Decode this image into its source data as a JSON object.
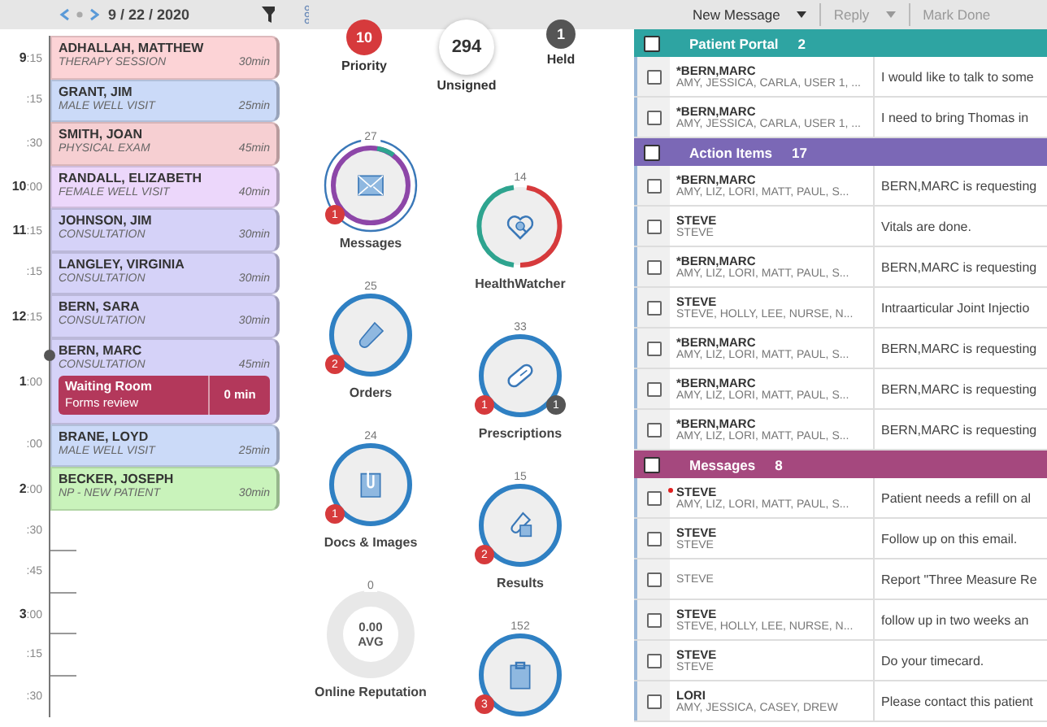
{
  "schedule": {
    "date": "9 / 22 / 2020",
    "slots": [
      {
        "time": "**9**:15",
        "patient": "ADHALLAH, MATTHEW",
        "visit": "THERAPY SESSION",
        "duration": "30min",
        "color": "#fcd3d6"
      },
      {
        "time": ":15",
        "patient": "GRANT, JIM",
        "visit": "MALE WELL VISIT",
        "duration": "25min",
        "color": "#cbdaf8"
      },
      {
        "time": ":30",
        "patient": "SMITH, JOAN",
        "visit": "PHYSICAL EXAM",
        "duration": "45min",
        "color": "#f6cfd2"
      },
      {
        "time": "**10**:00",
        "patient": "RANDALL, ELIZABETH",
        "visit": "FEMALE WELL VISIT",
        "duration": "40min",
        "color": "#ecd7fb"
      },
      {
        "time": "**11**:15",
        "patient": "JOHNSON, JIM",
        "visit": "CONSULTATION",
        "duration": "30min",
        "color": "#d5d2f8"
      },
      {
        "time": ":15",
        "patient": "LANGLEY, VIRGINIA",
        "visit": "CONSULTATION",
        "duration": "30min",
        "color": "#d5d2f8"
      },
      {
        "time": "**12**:15",
        "patient": "BERN, SARA",
        "visit": "CONSULTATION",
        "duration": "30min",
        "color": "#d5d2f8"
      },
      {
        "time": "**1**:00",
        "patient": "BERN, MARC",
        "visit": "CONSULTATION",
        "duration": "45min",
        "color": "#d5d2f8",
        "now": true,
        "waiting": {
          "title": "Waiting Room",
          "note": "Forms review",
          "wait": "0 min"
        }
      },
      {
        "time": ":00",
        "patient": "BRANE, LOYD",
        "visit": "MALE WELL VISIT",
        "duration": "25min",
        "color": "#cbdaf8"
      },
      {
        "time": "**2**:00",
        "patient": "BECKER, JOSEPH",
        "visit": "NP - NEW PATIENT",
        "duration": "30min",
        "color": "#c9f3bb"
      },
      {
        "time": ":30"
      },
      {
        "time": ":45"
      },
      {
        "time": "**3**:00"
      },
      {
        "time": ":15"
      },
      {
        "time": ":30"
      }
    ]
  },
  "stats": [
    {
      "label": "Priority",
      "count": "10",
      "kind": "alert"
    },
    {
      "label": "Unsigned",
      "count": "294",
      "kind": "plain"
    },
    {
      "label": "Held",
      "count": "1",
      "kind": "held"
    }
  ],
  "widget_columns": [
    [
      {
        "label": "Messages",
        "count": "27",
        "kind": "multi",
        "badges": [
          {
            "count": "1",
            "kind": "alert"
          }
        ]
      },
      {
        "label": "Orders",
        "count": "25",
        "kind": "ring",
        "badges": [
          {
            "count": "2",
            "kind": "alert"
          }
        ]
      },
      {
        "label": "Docs & Images",
        "count": "24",
        "kind": "ring",
        "badges": [
          {
            "count": "1",
            "kind": "alert"
          }
        ]
      },
      {
        "label": "Online Reputation",
        "count": "0",
        "kind": "rating",
        "score": "0.00",
        "unit": "AVG"
      }
    ],
    [
      {
        "label": "HealthWatcher",
        "count": "14",
        "kind": "split"
      },
      {
        "label": "Prescriptions",
        "count": "33",
        "kind": "ring",
        "badges": [
          {
            "count": "1",
            "kind": "alert"
          },
          {
            "count": "1",
            "kind": "held"
          }
        ]
      },
      {
        "label": "Results",
        "count": "15",
        "kind": "ring",
        "badges": [
          {
            "count": "2",
            "kind": "alert"
          }
        ]
      },
      {
        "count": "152",
        "kind": "ring",
        "badges": [
          {
            "count": "3",
            "kind": "alert"
          }
        ]
      }
    ]
  ],
  "toolbar": [
    {
      "label": "New Message",
      "dropdown": true,
      "disabled": false
    },
    {
      "label": "Reply",
      "dropdown": true,
      "disabled": true
    },
    {
      "label": "Mark Done",
      "dropdown": false,
      "disabled": true
    }
  ],
  "inbox": [
    {
      "title": "Patient Portal",
      "count": "2",
      "color": "#2ea4a2",
      "checked": false,
      "rows": [
        {
          "sender": "*BERN,MARC",
          "recipients": "AMY, JESSICA, CARLA, USER 1, ...",
          "preview": "I would like to talk to some",
          "checked": false
        },
        {
          "sender": "*BERN,MARC",
          "recipients": "AMY, JESSICA, CARLA, USER 1, ...",
          "preview": "I need to bring Thomas in",
          "checked": false
        }
      ]
    },
    {
      "title": "Action Items",
      "count": "17",
      "color": "#7b68b6",
      "checked": false,
      "rows": [
        {
          "sender": "*BERN,MARC",
          "recipients": "AMY, LIZ, LORI, MATT, PAUL, S...",
          "preview": "BERN,MARC is requesting",
          "checked": false
        },
        {
          "sender": "STEVE",
          "recipients": "STEVE",
          "preview": "Vitals are done.",
          "checked": false
        },
        {
          "sender": "*BERN,MARC",
          "recipients": "AMY, LIZ, LORI, MATT, PAUL, S...",
          "preview": "BERN,MARC is requesting",
          "checked": false
        },
        {
          "sender": "STEVE",
          "recipients": "STEVE, HOLLY, LEE, NURSE, N...",
          "preview": "Intraarticular Joint Injectio",
          "checked": false
        },
        {
          "sender": "*BERN,MARC",
          "recipients": "AMY, LIZ, LORI, MATT, PAUL, S...",
          "preview": "BERN,MARC is requesting",
          "checked": false
        },
        {
          "sender": "*BERN,MARC",
          "recipients": "AMY, LIZ, LORI, MATT, PAUL, S...",
          "preview": "BERN,MARC is requesting",
          "checked": false
        },
        {
          "sender": "*BERN,MARC",
          "recipients": "AMY, LIZ, LORI, MATT, PAUL, S...",
          "preview": "BERN,MARC is requesting",
          "checked": false
        }
      ]
    },
    {
      "title": "Messages",
      "count": "8",
      "color": "#a5487e",
      "checked": false,
      "rows": [
        {
          "sender": "STEVE",
          "recipients": "AMY, LIZ, LORI, MATT, PAUL, S...",
          "preview": "Patient needs a refill on al",
          "flagged": true,
          "checked": false
        },
        {
          "sender": "STEVE",
          "recipients": "STEVE",
          "preview": "Follow up on this email.",
          "checked": false
        },
        {
          "recipients": "STEVE",
          "preview": "Report \"Three Measure Re",
          "checked": false
        },
        {
          "sender": "STEVE",
          "recipients": "STEVE, HOLLY, LEE, NURSE, N...",
          "preview": "follow up in two weeks an",
          "checked": false
        },
        {
          "sender": "STEVE",
          "recipients": "STEVE",
          "preview": "Do your timecard.",
          "checked": false
        },
        {
          "sender": "LORI",
          "recipients": "AMY, JESSICA, CASEY, DREW",
          "preview": "Please contact this patient",
          "checked": false
        }
      ]
    }
  ]
}
